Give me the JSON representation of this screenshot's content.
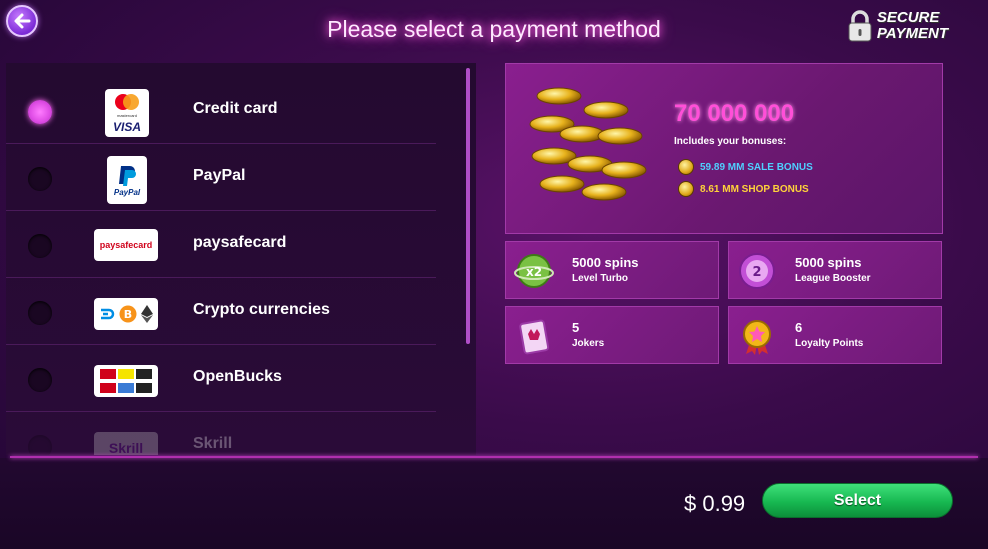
{
  "header": {
    "title": "Please select a payment method",
    "secure_line1": "SECURE",
    "secure_line2": "PAYMENT"
  },
  "payment_methods": [
    {
      "label": "Credit card",
      "selected": true,
      "logo_text": "VISA",
      "logo_sub": "mastercard"
    },
    {
      "label": "PayPal",
      "selected": false,
      "logo_text": "PayPal"
    },
    {
      "label": "paysafecard",
      "selected": false,
      "logo_text": "paysafecard"
    },
    {
      "label": "Crypto currencies",
      "selected": false
    },
    {
      "label": "OpenBucks",
      "selected": false
    },
    {
      "label": "Skrill",
      "selected": false,
      "logo_text": "Skrill"
    }
  ],
  "offer": {
    "amount": "70 000 000",
    "includes": "Includes your bonuses:",
    "sale_bonus": "59.89 MM SALE BONUS",
    "shop_bonus": "8.61 MM SHOP BONUS",
    "sale_color": "#4fd0ff",
    "shop_color": "#ffd23a",
    "multiplier_label": "x2"
  },
  "rewards": [
    {
      "value": "5000 spins",
      "label": "Level Turbo",
      "icon": "level-turbo-icon"
    },
    {
      "value": "5000 spins",
      "label": "League Booster",
      "icon": "league-booster-icon"
    },
    {
      "value": "5",
      "label": "Jokers",
      "icon": "joker-icon"
    },
    {
      "value": "6",
      "label": "Loyalty Points",
      "icon": "loyalty-icon"
    }
  ],
  "footer": {
    "price": "$ 0.99",
    "select_label": "Select"
  },
  "colors": {
    "accent": "#ff4fd8",
    "select_green": "#17b851"
  }
}
